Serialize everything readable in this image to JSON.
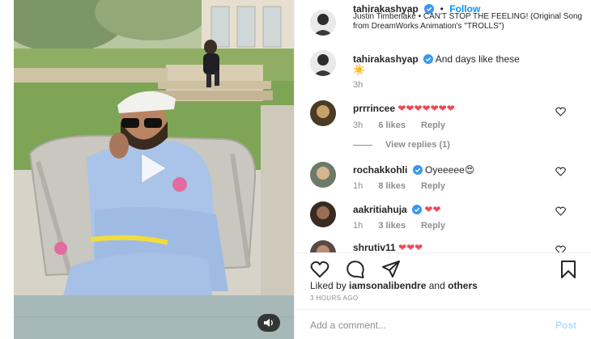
{
  "post": {
    "username": "tahirakashyap",
    "follow_label": "Follow",
    "separator": "•",
    "audio": "Justin Timberlake • CAN'T STOP THE FEELING! (Original Song from DreamWorks Animation's \"TROLLS\")",
    "caption_username": "tahirakashyap",
    "caption_text": "And days like these",
    "caption_emoji": "☀️",
    "caption_time": "3h"
  },
  "comments": [
    {
      "username": "prrrincee",
      "text": "❤❤❤❤❤❤❤",
      "time": "3h",
      "likes": "6 likes",
      "reply": "Reply",
      "verified": false
    },
    {
      "username": "rochakkohli",
      "text": "Oyeeeee😍",
      "time": "1h",
      "likes": "8 likes",
      "reply": "Reply",
      "verified": true
    },
    {
      "username": "aakritiahuja",
      "text": "❤❤",
      "time": "1h",
      "likes": "3 likes",
      "reply": "Reply",
      "verified": true
    },
    {
      "username": "shrutiv11",
      "text": "❤❤❤",
      "time": "",
      "likes": "",
      "reply": "",
      "verified": false
    }
  ],
  "view_replies": "View replies (1)",
  "likes_line": {
    "prefix": "Liked by ",
    "user": "iamsonalibendre",
    "middle": " and ",
    "suffix": "others"
  },
  "time_ago": "3 HOURS AGO",
  "composer": {
    "placeholder": "Add a comment...",
    "post_label": "Post"
  },
  "colors": {
    "accent": "#0095f6",
    "heart": "#ed4956",
    "muted": "#8e8e8e"
  },
  "icons": [
    "heart-icon",
    "comment-icon",
    "share-icon",
    "bookmark-icon",
    "play-icon",
    "volume-icon",
    "verified-badge-icon"
  ]
}
